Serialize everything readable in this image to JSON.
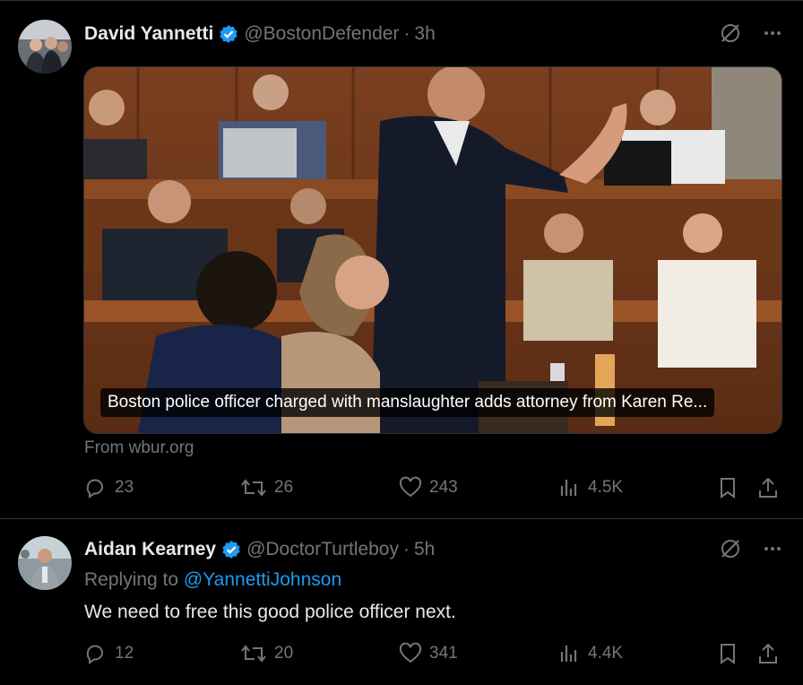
{
  "post1": {
    "name": "David Yannetti",
    "handle": "@BostonDefender",
    "time": "3h",
    "card_title": "Boston police officer charged with manslaughter adds attorney from Karen Re...",
    "source": "From wbur.org",
    "replies": "23",
    "reposts": "26",
    "likes": "243",
    "views": "4.5K"
  },
  "post2": {
    "name": "Aidan Kearney",
    "handle": "@DoctorTurtleboy",
    "time": "5h",
    "replying_prefix": "Replying to",
    "replying_handle": "@YannettiJohnson",
    "text": "We need to free this good police officer next.",
    "replies": "12",
    "reposts": "20",
    "likes": "341",
    "views": "4.4K"
  },
  "colors": {
    "verified": "#1d9bf0",
    "muted": "#71767b",
    "text": "#e7e9ea",
    "background": "#000000"
  }
}
